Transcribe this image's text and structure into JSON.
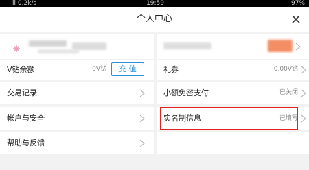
{
  "status_bar": {
    "left": "il 0.2k/s",
    "time": "19:59",
    "right": "97%"
  },
  "header": {
    "title": "个人中心"
  },
  "profile": {
    "left": {
      "avatar_color": "#e8a1b3"
    },
    "right": {
      "badge_color": "#f07a4a"
    }
  },
  "rows": {
    "vcoin": {
      "label": "V钻余额",
      "value": "0V钻",
      "button": "充 值"
    },
    "coupon": {
      "label": "礼券",
      "value": "0.00V钻"
    },
    "trade": {
      "label": "交易记录"
    },
    "pay": {
      "label": "小额免密支付",
      "value": "已关闭"
    },
    "account": {
      "label": "帐户与安全"
    },
    "realname": {
      "label": "实名制信息",
      "value": "已填写"
    },
    "help": {
      "label": "帮助与反馈"
    }
  },
  "colors": {
    "accent": "#2b8fd6",
    "highlight": "#e0231b"
  },
  "icons": {
    "close": "close-icon",
    "chevron": "chevron-right-icon"
  }
}
